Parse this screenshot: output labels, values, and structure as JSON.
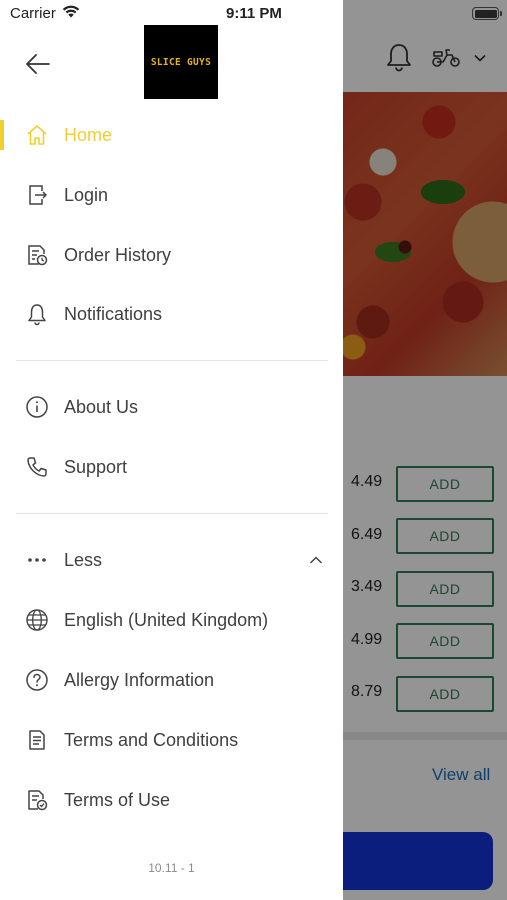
{
  "status_bar": {
    "carrier": "Carrier",
    "time": "9:11 PM"
  },
  "drawer": {
    "logo_text": "SLICE GUYS",
    "menu_primary": [
      {
        "label": "Home",
        "icon": "home-icon",
        "active": true
      },
      {
        "label": "Login",
        "icon": "login-icon"
      },
      {
        "label": "Order History",
        "icon": "order-history-icon"
      },
      {
        "label": "Notifications",
        "icon": "bell-icon"
      }
    ],
    "menu_secondary": [
      {
        "label": "About Us",
        "icon": "info-icon"
      },
      {
        "label": "Support",
        "icon": "phone-icon"
      }
    ],
    "less_label": "Less",
    "menu_more": [
      {
        "label": "English (United Kingdom)",
        "icon": "globe-icon"
      },
      {
        "label": "Allergy Information",
        "icon": "question-icon"
      },
      {
        "label": "Terms and Conditions",
        "icon": "document-icon"
      },
      {
        "label": "Terms of Use",
        "icon": "document-check-icon"
      }
    ],
    "version": "10.11 - 1"
  },
  "background": {
    "prices": [
      "4.49",
      "6.49",
      "3.49",
      "4.99",
      "8.79"
    ],
    "add_label": "ADD",
    "view_all": "View all"
  },
  "colors": {
    "accent": "#f2cf2f",
    "add_green": "#2f7d55",
    "link_blue": "#1b6fb8",
    "cta_blue": "#1435d8"
  }
}
